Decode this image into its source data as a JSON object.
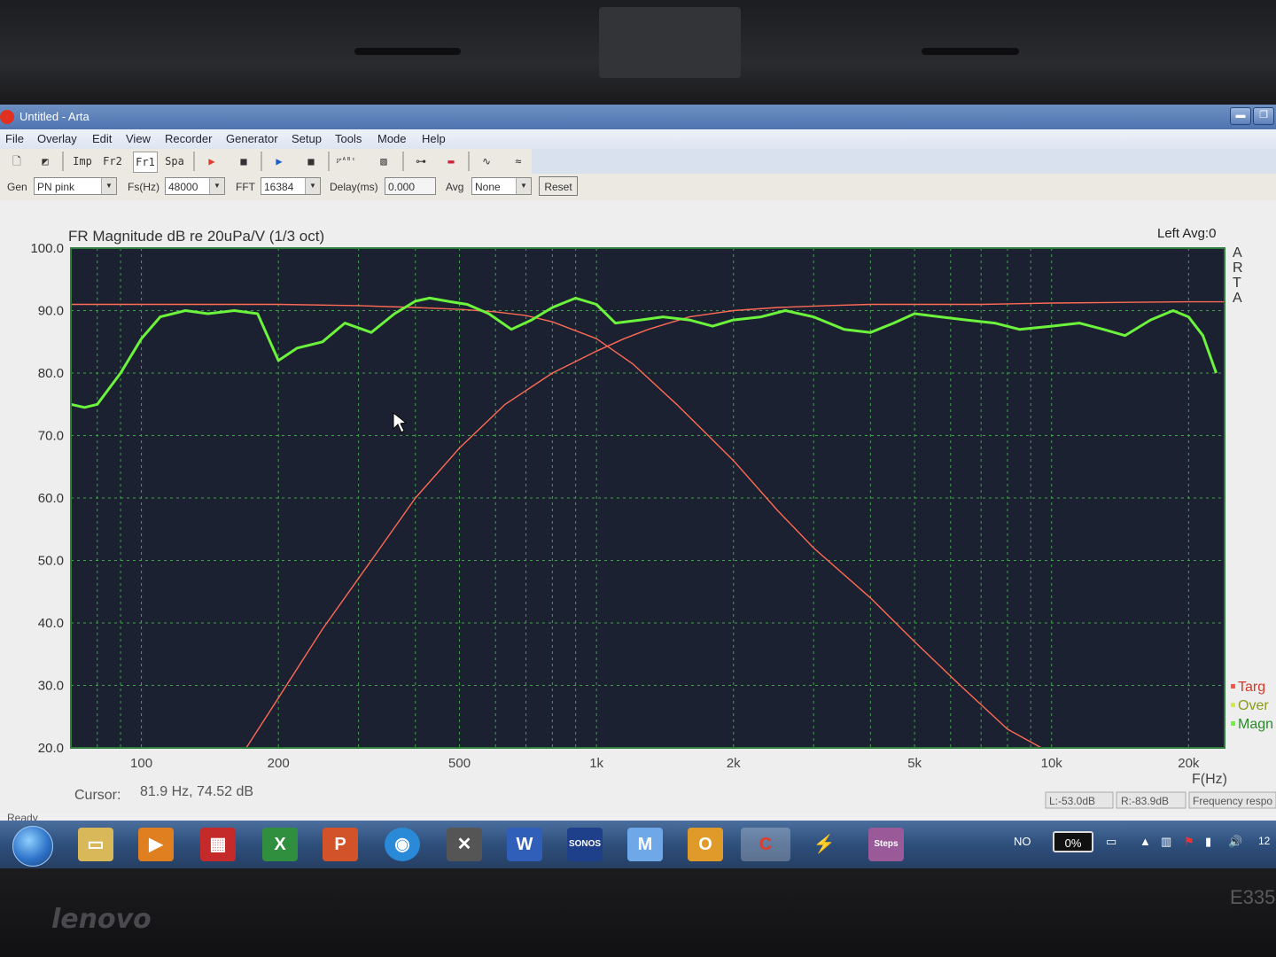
{
  "window": {
    "title": "Untitled - Arta"
  },
  "menu": [
    "File",
    "Overlay",
    "Edit",
    "View",
    "Recorder",
    "Generator",
    "Setup",
    "Tools",
    "Mode",
    "Help"
  ],
  "toolbar": {
    "imp": "Imp",
    "fr2": "Fr2",
    "fr1": "Fr1",
    "spa": "Spa"
  },
  "controls": {
    "gen_label": "Gen",
    "gen_value": "PN pink",
    "fs_label": "Fs(Hz)",
    "fs_value": "48000",
    "fft_label": "FFT",
    "fft_value": "16384",
    "delay_label": "Delay(ms)",
    "delay_value": "0.000",
    "avg_label": "Avg",
    "avg_value": "None",
    "reset_label": "Reset"
  },
  "chart_data": {
    "type": "line",
    "title": "FR Magnitude dB re 20uPa/V (1/3 oct)",
    "channel_info": "Left  Avg:0",
    "side_label": "ARTA",
    "xlabel": "F(Hz)",
    "x_scale": "log",
    "xlim": [
      70,
      24000
    ],
    "ylim": [
      20,
      100
    ],
    "grid": true,
    "yticks": [
      "100.0",
      "90.0",
      "80.0",
      "70.0",
      "60.0",
      "50.0",
      "40.0",
      "30.0",
      "20.0"
    ],
    "xticks": [
      {
        "value": 100,
        "label": "100"
      },
      {
        "value": 200,
        "label": "200"
      },
      {
        "value": 500,
        "label": "500"
      },
      {
        "value": 1000,
        "label": "1k"
      },
      {
        "value": 2000,
        "label": "2k"
      },
      {
        "value": 5000,
        "label": "5k"
      },
      {
        "value": 10000,
        "label": "10k"
      },
      {
        "value": 20000,
        "label": "20k"
      }
    ],
    "legend": {
      "position": "right",
      "entries": [
        "Targ",
        "Over",
        "Magn"
      ]
    },
    "series": [
      {
        "name": "Magn",
        "color": "#6cf43c",
        "x": [
          70,
          75,
          80,
          90,
          100,
          110,
          125,
          140,
          160,
          180,
          200,
          220,
          250,
          280,
          320,
          360,
          400,
          430,
          470,
          520,
          580,
          650,
          720,
          800,
          900,
          1000,
          1100,
          1250,
          1400,
          1600,
          1800,
          2000,
          2300,
          2600,
          3000,
          3500,
          4000,
          4500,
          5000,
          5700,
          6500,
          7500,
          8500,
          10000,
          11500,
          13000,
          14500,
          16500,
          18500,
          20000,
          21500,
          23000
        ],
        "y": [
          75,
          74.5,
          75,
          80,
          85.5,
          89,
          90,
          89.5,
          90,
          89.5,
          82,
          84,
          85,
          88,
          86.5,
          89.5,
          91.5,
          92,
          91.5,
          91,
          89.5,
          87,
          88.5,
          90.5,
          92,
          91,
          88,
          88.5,
          89,
          88.5,
          87.5,
          88.5,
          89,
          90,
          89,
          87,
          86.5,
          88,
          89.5,
          89,
          88.5,
          88,
          87,
          87.5,
          88,
          87,
          86,
          88.5,
          90,
          89,
          86,
          80
        ]
      },
      {
        "name": "Over",
        "color": "#ff6a55",
        "x": [
          170,
          200,
          250,
          320,
          400,
          500,
          630,
          800,
          1000,
          1150,
          1300,
          1600,
          2000,
          2500,
          3200,
          4000,
          5000,
          7000,
          10000,
          14000,
          20000,
          24000
        ],
        "y": [
          20,
          28,
          39,
          50,
          60,
          68,
          75,
          80,
          83.5,
          85.5,
          87,
          89,
          90,
          90.5,
          90.8,
          91,
          91,
          91,
          91.2,
          91.3,
          91.4,
          91.4
        ]
      },
      {
        "name": "Targ",
        "color": "#ff6a55",
        "x": [
          70,
          100,
          150,
          200,
          300,
          400,
          500,
          600,
          700,
          800,
          1000,
          1200,
          1500,
          2000,
          2500,
          3000,
          4000,
          5000,
          6300,
          8000,
          9500
        ],
        "y": [
          91,
          91,
          91,
          91,
          90.8,
          90.5,
          90.2,
          89.8,
          89.2,
          88.2,
          85.5,
          81.5,
          75,
          66,
          58,
          52,
          44,
          37,
          30,
          23,
          20
        ]
      }
    ]
  },
  "cursor": {
    "label": "Cursor:",
    "value": "81.9 Hz, 74.52 dB"
  },
  "readouts": {
    "left": "L:-53.0dB",
    "right": "R:-83.9dB",
    "mode": "Frequency respo"
  },
  "status": "Ready",
  "taskbar": {
    "tray_lang": "NO",
    "tray_percent": "0%",
    "tray_clock": "12"
  },
  "device": {
    "brand": "lenovo",
    "model": "E335"
  }
}
